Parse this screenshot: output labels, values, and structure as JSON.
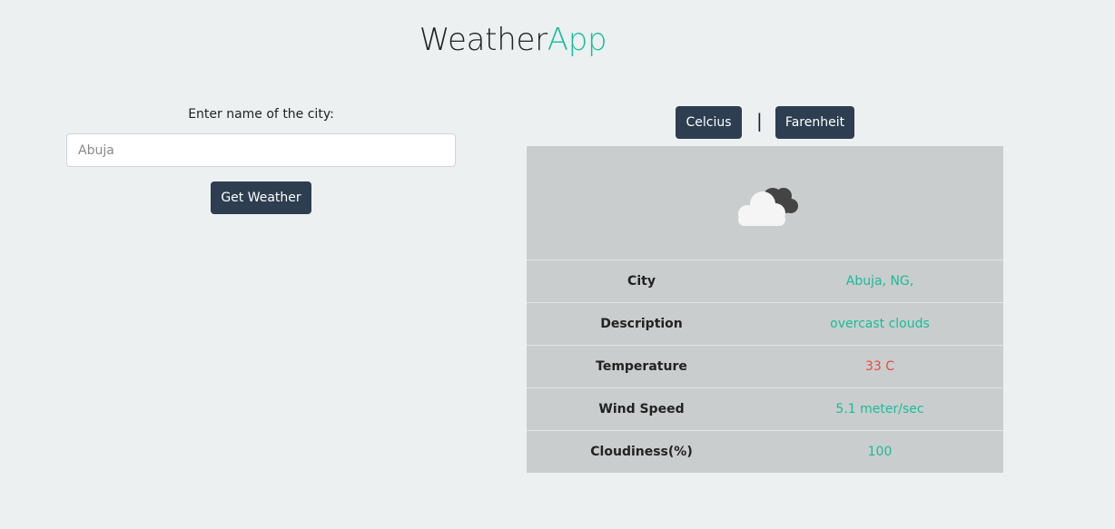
{
  "app": {
    "title_main": "Weather",
    "title_accent": "App"
  },
  "search": {
    "label": "Enter name of the city:",
    "placeholder": "Abuja",
    "value": "",
    "button_label": "Get Weather"
  },
  "units": {
    "celcius_label": "Celcius",
    "separator": "|",
    "farenheit_label": "Farenheit"
  },
  "weather": {
    "icon": "overcast-clouds-icon",
    "rows": [
      {
        "label": "City",
        "value": "Abuja, NG,"
      },
      {
        "label": "Description",
        "value": "overcast clouds"
      },
      {
        "label": "Temperature",
        "value": "33 C"
      },
      {
        "label": "Wind Speed",
        "value": "5.1 meter/sec"
      },
      {
        "label": "Cloudiness(%)",
        "value": "100"
      }
    ]
  },
  "colors": {
    "background": "#ecf0f1",
    "accent": "#18bc9c",
    "button": "#2c3e50",
    "temperature": "#e74c3c",
    "card": "#cacdcd"
  }
}
